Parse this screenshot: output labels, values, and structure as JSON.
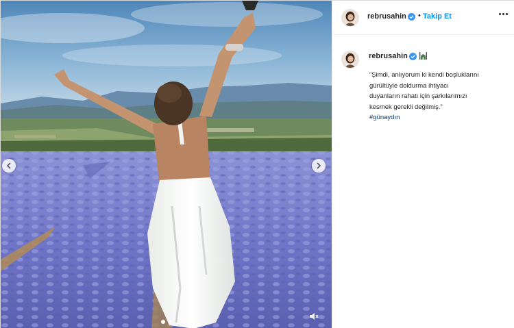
{
  "post": {
    "header": {
      "username": "rebrusahin",
      "separator": "•",
      "follow_label": "Takip Et",
      "verified_icon": "verified-badge-icon",
      "more_icon": "more-options-icon"
    },
    "caption": {
      "username": "rebrusahin",
      "emoji_icon": "mosque-emoji-icon",
      "lines": [
        "“Şimdi, anlıyorum ki kendi boşluklarını",
        "gürültüyle doldurma ihtiyacı",
        "duyanların rahatı için şarkılarımızı",
        "kesmek gerekli değilmiş.”"
      ],
      "hashtag": "#günaydın"
    },
    "media": {
      "description_icon": "lavender-field-photo",
      "prev_icon": "chevron-left-icon",
      "next_icon": "chevron-right-icon",
      "mute_icon": "speaker-muted-icon",
      "dots_count": 2,
      "active_dot": 1
    },
    "colors": {
      "accent": "#0095f6",
      "verified": "#3897f0",
      "hashtag": "#00376b",
      "text": "#262626"
    }
  }
}
